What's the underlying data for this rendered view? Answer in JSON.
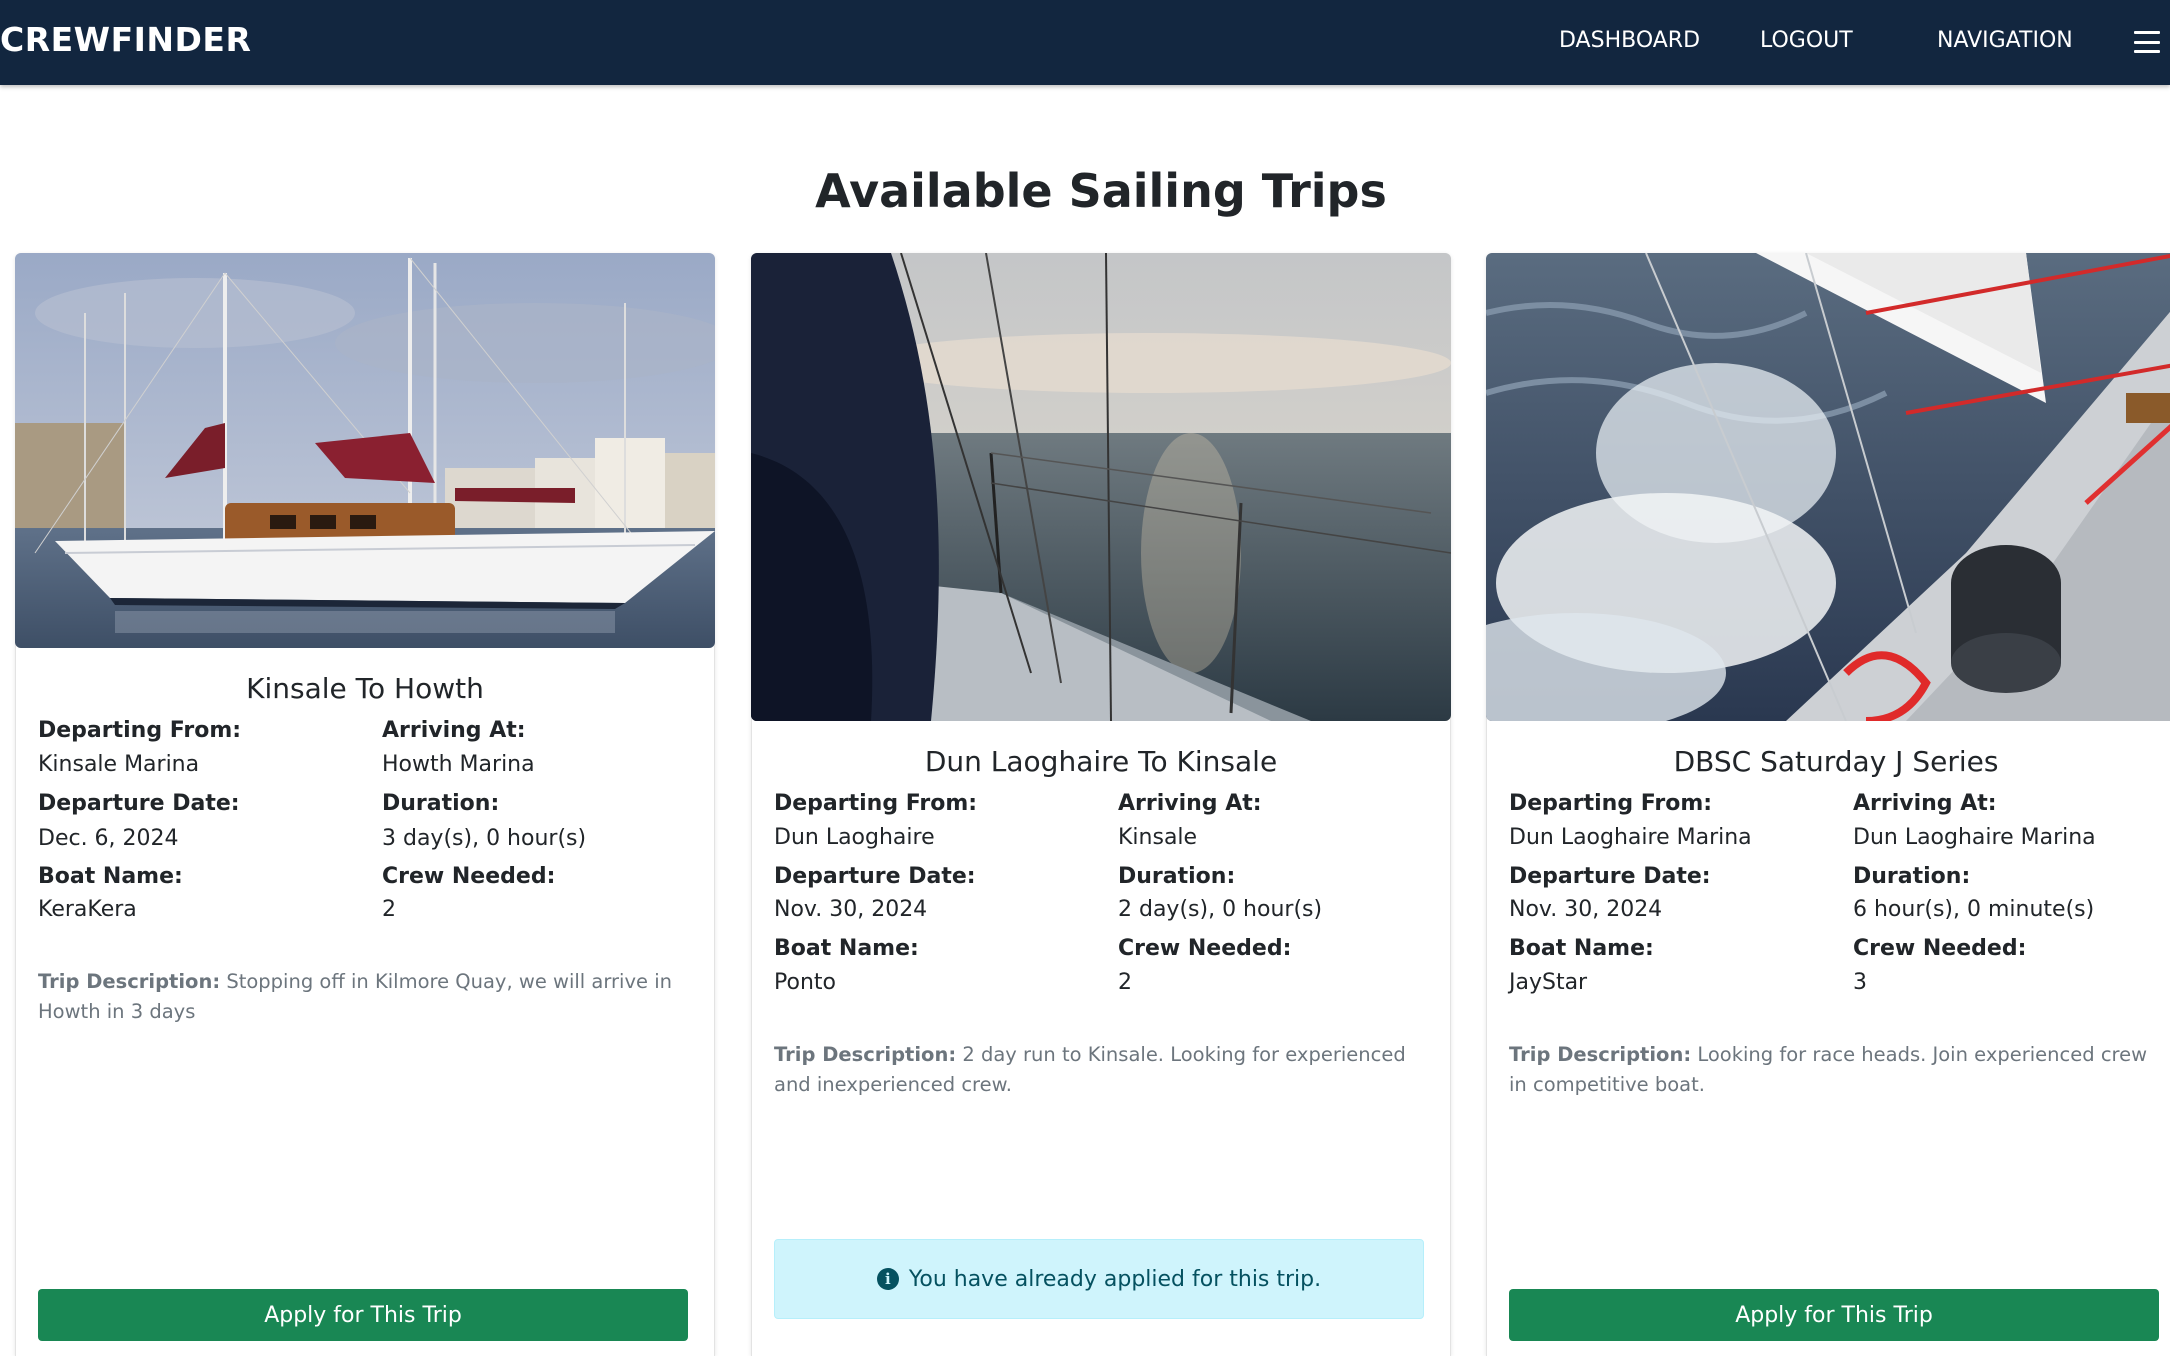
{
  "navbar": {
    "brand": "CREWFINDER",
    "links": [
      "DASHBOARD",
      "LOGOUT",
      "NAVIGATION"
    ],
    "menu_icon": "hamburger-menu-icon",
    "background": "#12263f"
  },
  "page": {
    "title": "Available Sailing Trips"
  },
  "labels": {
    "departing_from": "Departing From:",
    "arriving_at": "Arriving At:",
    "departure_date": "Departure Date:",
    "duration": "Duration:",
    "boat_name": "Boat Name:",
    "crew_needed": "Crew Needed:",
    "trip_description": "Trip Description:"
  },
  "trips": [
    {
      "title": "Kinsale To Howth",
      "departing_from": "Kinsale Marina",
      "arriving_at": "Howth Marina",
      "departure_date": "Dec. 6, 2024",
      "duration": "3 day(s), 0 hour(s)",
      "boat_name": "KeraKera",
      "crew_needed": "2",
      "description": "Stopping off in Kilmore Quay, we will arrive in Howth in 3 days",
      "action": "Apply for This Trip",
      "image": "sailboat-in-marina-photo"
    },
    {
      "title": "Dun Laoghaire To Kinsale",
      "departing_from": "Dun Laoghaire",
      "arriving_at": "Kinsale",
      "departure_date": "Nov. 30, 2024",
      "duration": "2 day(s), 0 hour(s)",
      "boat_name": "Ponto",
      "crew_needed": "2",
      "description": "2 day run to Kinsale. Looking for experienced and inexperienced crew.",
      "status": "You have already applied for this trip.",
      "image": "sea-sunset-from-deck-photo"
    },
    {
      "title": "DBSC Saturday J Series",
      "departing_from": "Dun Laoghaire Marina",
      "arriving_at": "Dun Laoghaire Marina",
      "departure_date": "Nov. 30, 2024",
      "duration": "6 hour(s), 0 minute(s)",
      "boat_name": "JayStar",
      "crew_needed": "3",
      "description": "Looking for race heads. Join experienced crew in competitive boat.",
      "action": "Apply for This Trip",
      "image": "racing-yacht-spray-photo"
    }
  ],
  "colors": {
    "apply_button": "#198754",
    "info_alert_bg": "#cff4fc",
    "info_alert_text": "#055160"
  }
}
